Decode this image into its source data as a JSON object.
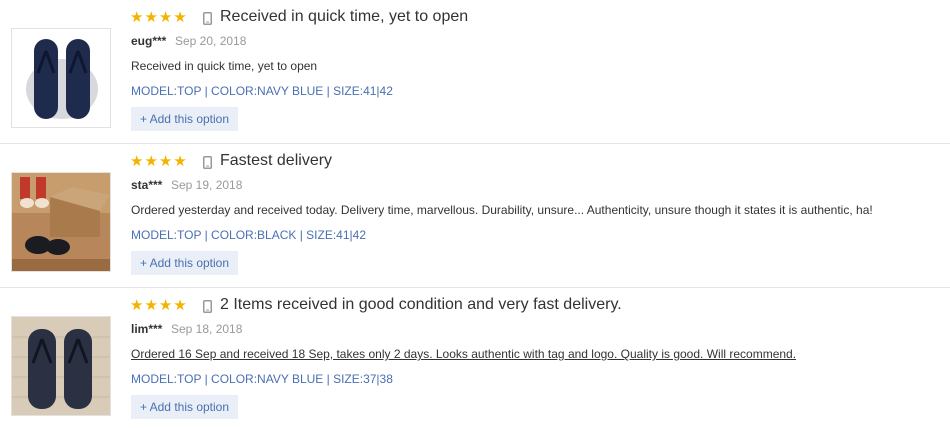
{
  "reviews": [
    {
      "title": "Received in quick time, yet to open",
      "rating": 4,
      "user": "eug***",
      "date": "Sep 20, 2018",
      "text": "Received in quick time, yet to open",
      "sku": "MODEL:TOP | COLOR:NAVY BLUE | SIZE:41|42",
      "add_label": "+ Add this option"
    },
    {
      "title": "Fastest delivery",
      "rating": 4,
      "user": "sta***",
      "date": "Sep 19, 2018",
      "text": "Ordered yesterday and received today. Delivery time, marvellous. Durability, unsure... Authenticity, unsure though it states it is authentic, ha!",
      "sku": "MODEL:TOP | COLOR:BLACK | SIZE:41|42",
      "add_label": "+ Add this option"
    },
    {
      "title": "2 Items received in good condition and very fast delivery.",
      "rating": 4,
      "user": "lim***",
      "date": "Sep 18, 2018",
      "text": "Ordered 16 Sep and received 18 Sep, takes only 2 days. Looks authentic with tag and logo. Quality is good. Will recommend.",
      "sku": "MODEL:TOP | COLOR:NAVY BLUE | SIZE:37|38",
      "add_label": "+ Add this option"
    }
  ],
  "icons": {
    "star": "star-icon",
    "device": "mobile-device-icon"
  },
  "colors": {
    "star": "#f5b301",
    "link": "#4a6fb3",
    "button_bg": "#eaeff7"
  }
}
